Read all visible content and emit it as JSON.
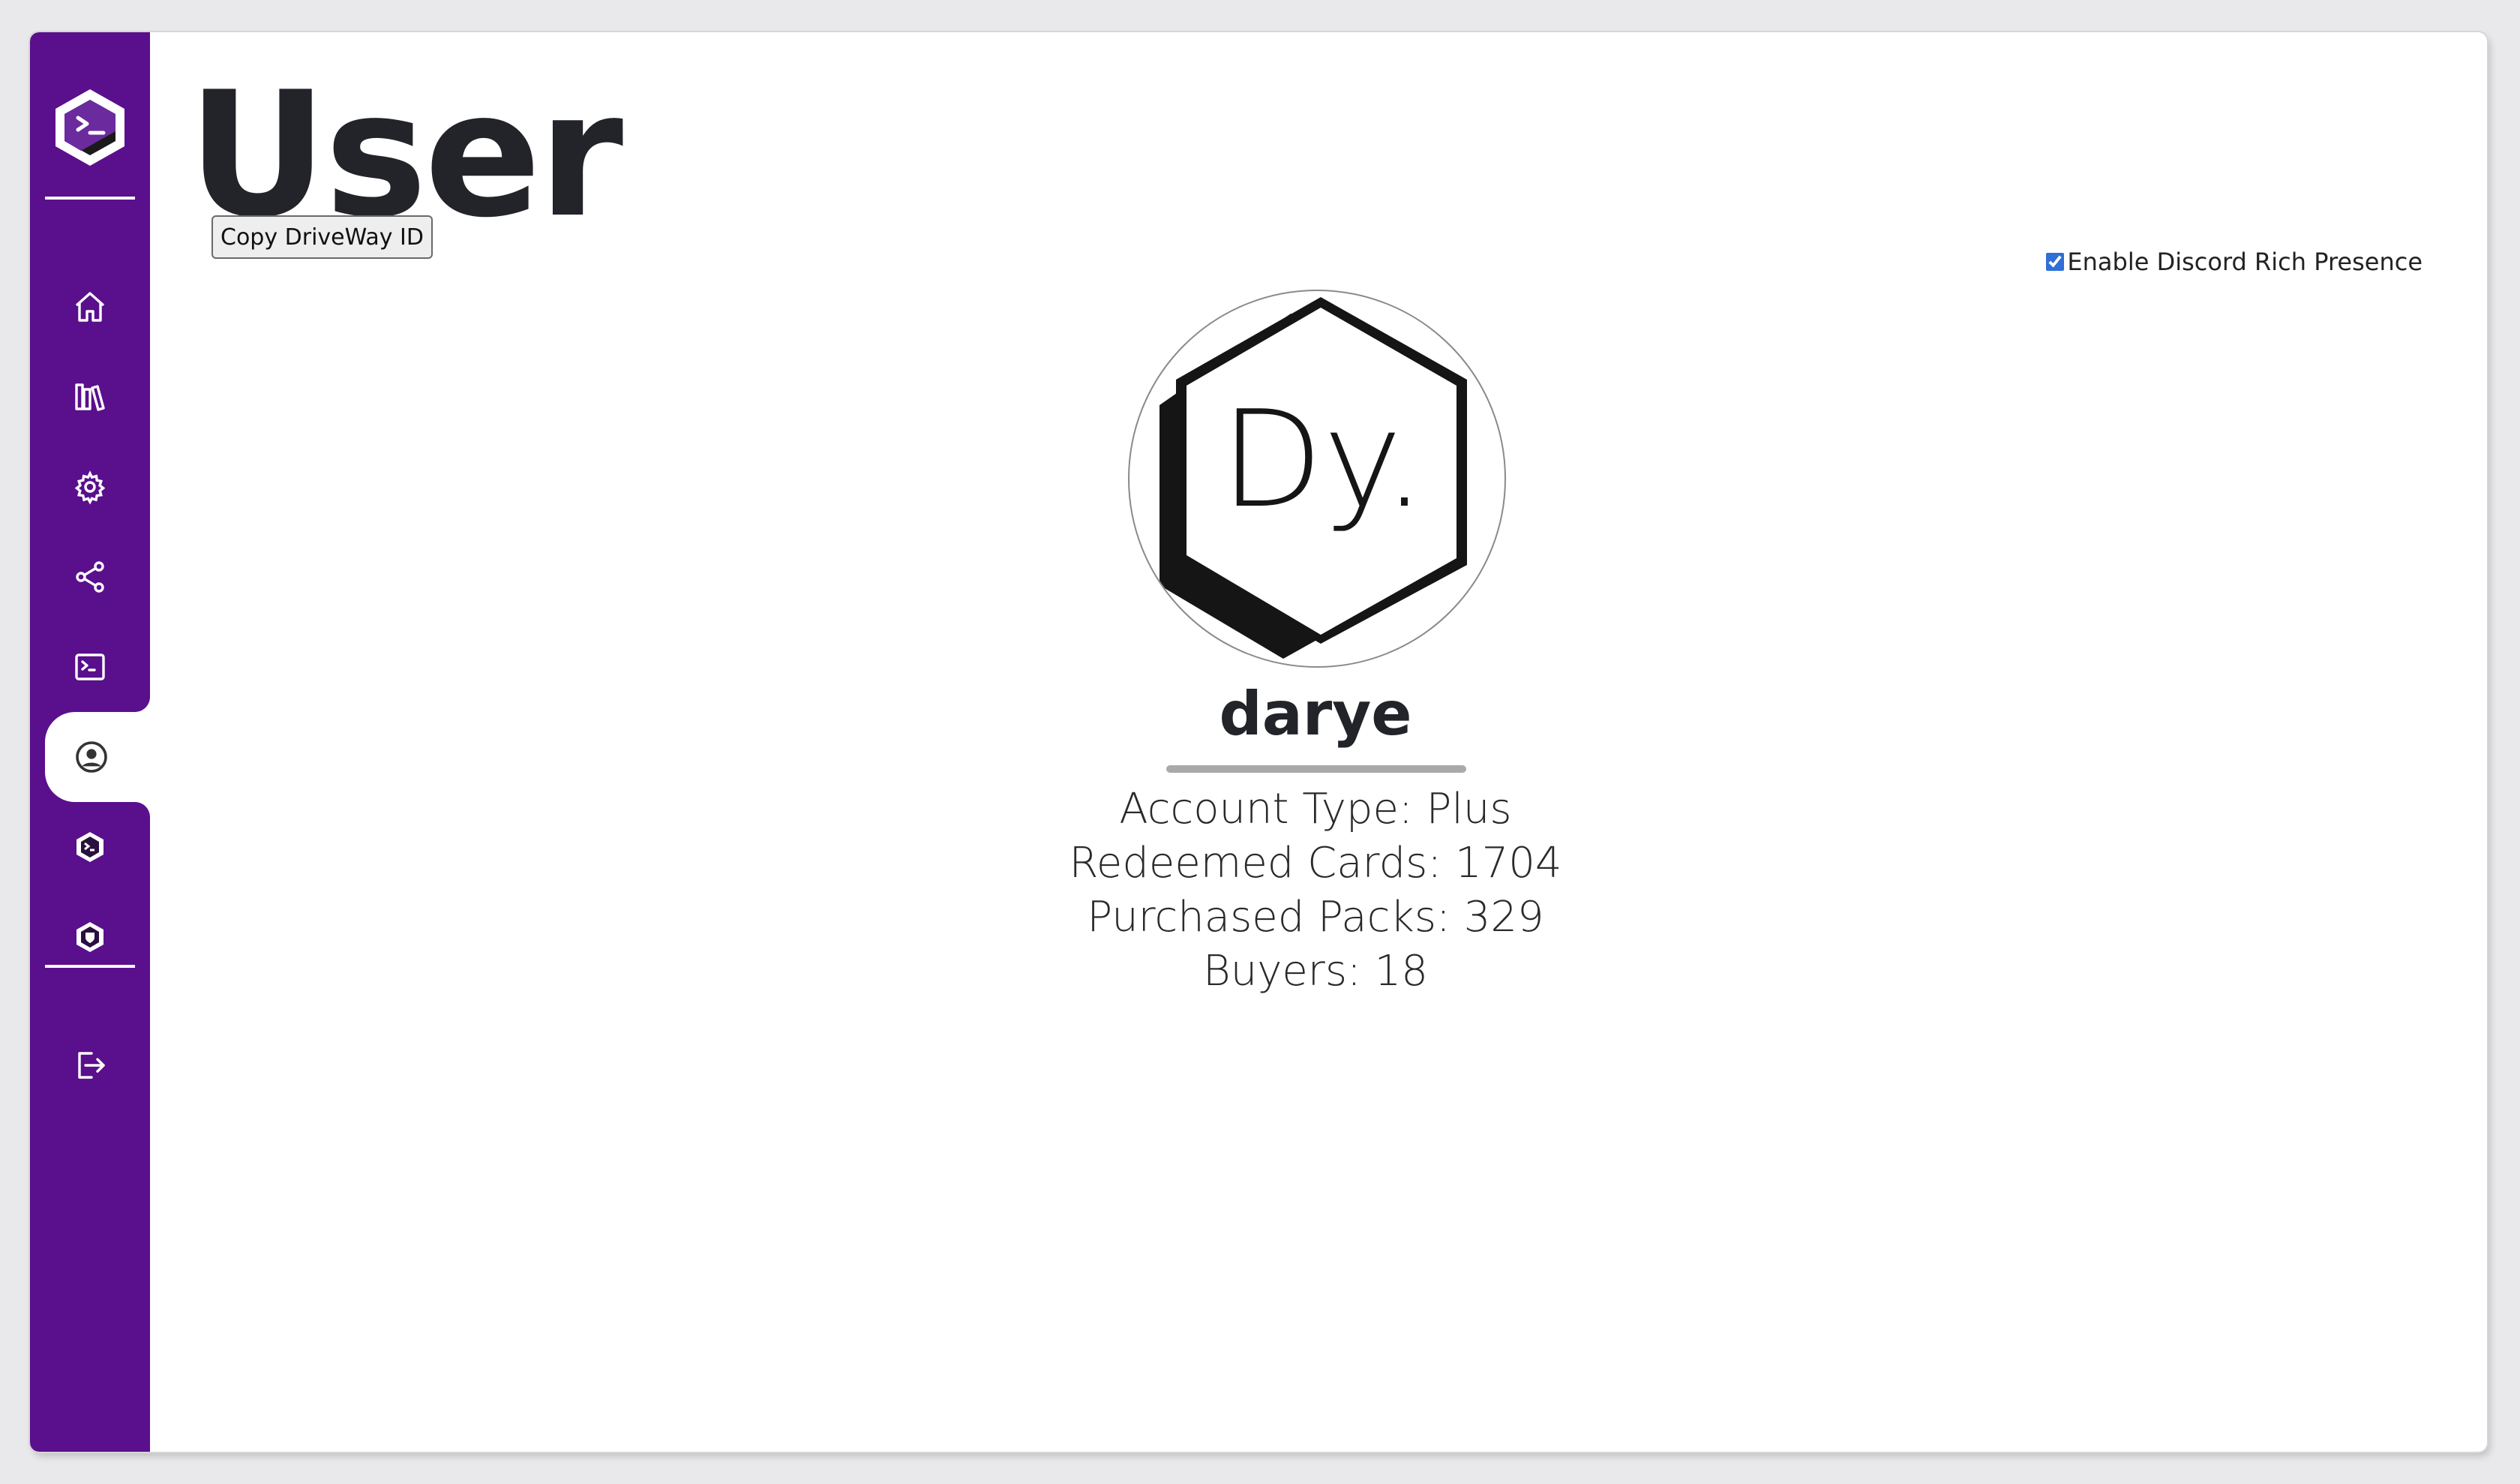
{
  "page": {
    "title": "User"
  },
  "toolbar": {
    "copy_id_label": "Copy DriveWay ID"
  },
  "discord": {
    "label": "Enable Discord Rich Presence",
    "checked": true
  },
  "sidebar": {
    "items": [
      {
        "name": "home",
        "icon": "home-icon"
      },
      {
        "name": "library",
        "icon": "library-icon"
      },
      {
        "name": "settings",
        "icon": "gear-icon"
      },
      {
        "name": "share",
        "icon": "share-icon"
      },
      {
        "name": "terminal",
        "icon": "terminal-icon"
      },
      {
        "name": "user",
        "icon": "user-circle-icon",
        "active": true
      },
      {
        "name": "app-badge-1",
        "icon": "terminal-badge-icon"
      },
      {
        "name": "app-badge-2",
        "icon": "shield-badge-icon"
      },
      {
        "name": "logout",
        "icon": "logout-icon"
      }
    ]
  },
  "profile": {
    "avatar_text": "Dy.",
    "username": "darye",
    "stats": {
      "account_type": "Account Type: Plus",
      "redeemed_cards": "Redeemed Cards: 1704",
      "purchased_packs": "Purchased Packs: 329",
      "buyers": "Buyers: 18"
    }
  },
  "colors": {
    "sidebar": "#5a0f8c",
    "title": "#222429",
    "background": "#ffffff"
  }
}
